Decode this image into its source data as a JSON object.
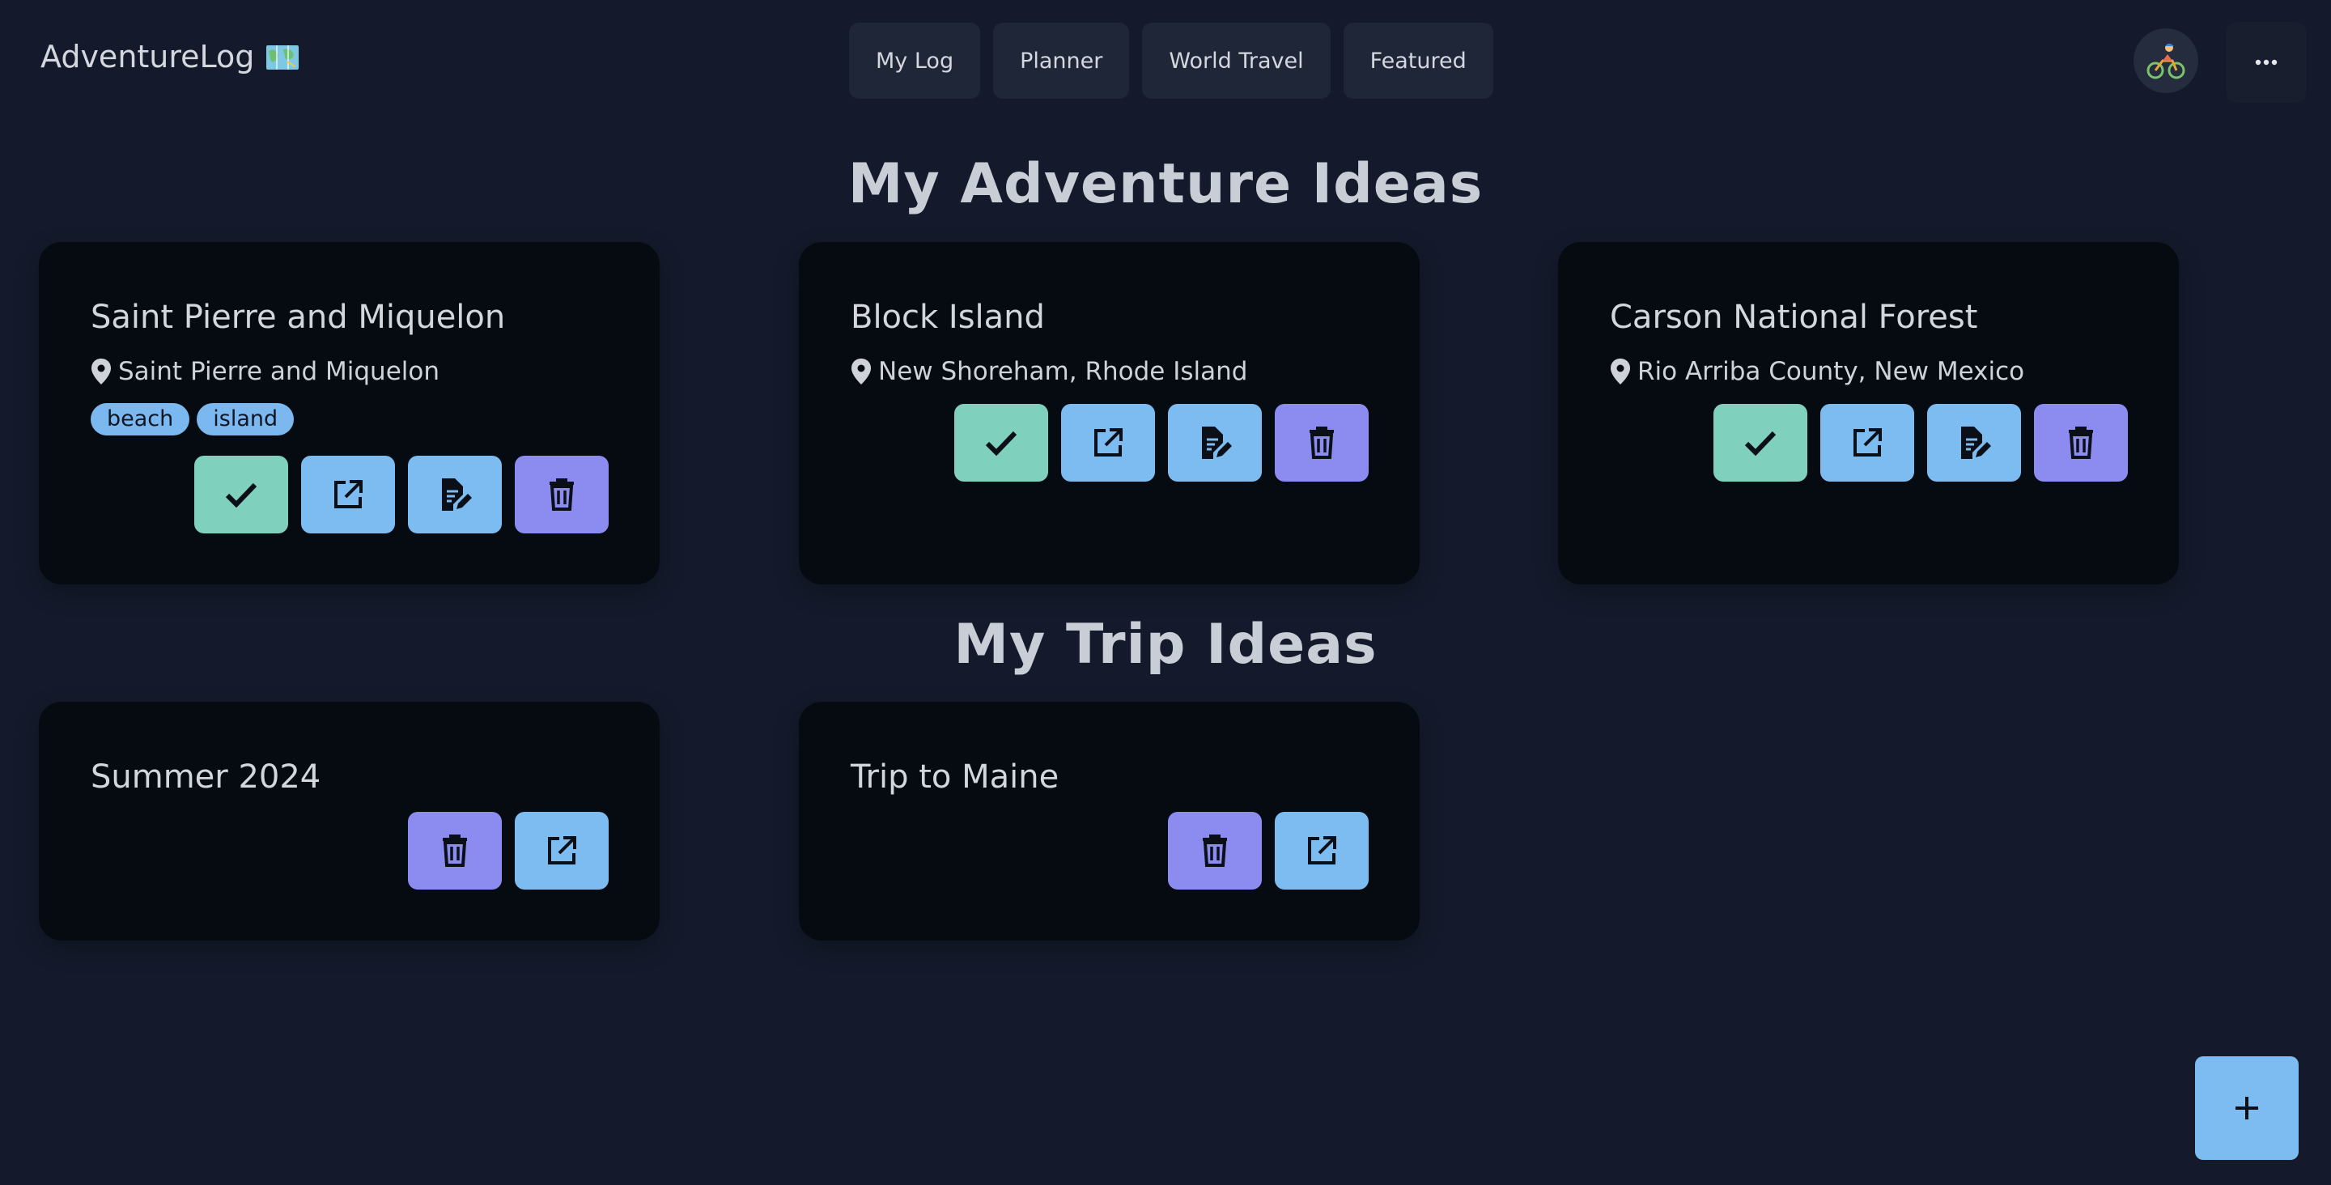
{
  "brand": {
    "title": "AdventureLog"
  },
  "nav": {
    "items": [
      {
        "label": "My Log"
      },
      {
        "label": "Planner"
      },
      {
        "label": "World Travel"
      },
      {
        "label": "Featured"
      }
    ]
  },
  "more_menu": {
    "label": "···"
  },
  "adventures": {
    "heading": "My Adventure Ideas",
    "cards": [
      {
        "title": "Saint Pierre and Miquelon",
        "location": "Saint Pierre and Miquelon",
        "tags": [
          "beach",
          "island"
        ]
      },
      {
        "title": "Block Island",
        "location": "New Shoreham, Rhode Island",
        "tags": []
      },
      {
        "title": "Carson National Forest",
        "location": "Rio Arriba County, New Mexico",
        "tags": []
      }
    ]
  },
  "trips": {
    "heading": "My Trip Ideas",
    "cards": [
      {
        "title": "Summer 2024"
      },
      {
        "title": "Trip to Maine"
      }
    ]
  },
  "icons": {
    "check": "check-icon",
    "open": "open-external-icon",
    "edit": "edit-document-icon",
    "delete": "trash-icon",
    "location": "map-pin-icon",
    "add": "plus-icon",
    "brand": "world-map-icon",
    "avatar": "cyclist-avatar-icon",
    "more": "ellipsis-icon"
  },
  "colors": {
    "background": "#141a2b",
    "card": "#060b12",
    "green": "#7fd0bd",
    "blue": "#7cbcf1",
    "purple": "#8c8cf0"
  }
}
